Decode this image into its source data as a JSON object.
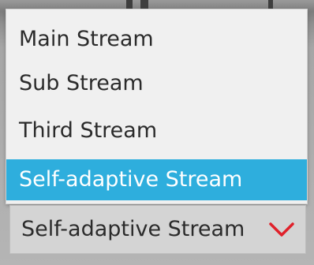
{
  "stream_select": {
    "selected_value": "Self-adaptive Stream",
    "options": [
      {
        "label": "Main Stream",
        "selected": false
      },
      {
        "label": "Sub Stream",
        "selected": false
      },
      {
        "label": "Third Stream",
        "selected": false
      },
      {
        "label": "Self-adaptive Stream",
        "selected": true
      }
    ]
  },
  "icons": {
    "dropdown_arrow": "chevron-down-icon"
  },
  "colors": {
    "selected_option_background": "#2eaedd",
    "selected_option_text": "#ffffff",
    "option_text": "#2b2b2b",
    "menu_background": "#f0f0f0",
    "select_background": "#d4d4d4",
    "chevron": "#e0202a"
  }
}
